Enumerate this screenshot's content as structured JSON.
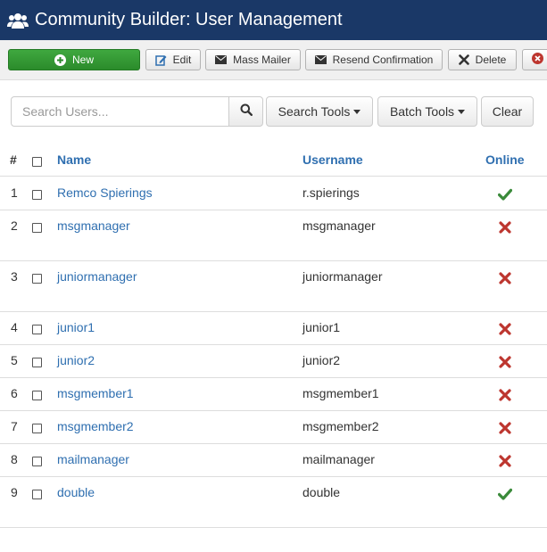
{
  "header": {
    "title": "Community Builder: User Management",
    "icon": "users-icon"
  },
  "toolbar": {
    "new_label": "New",
    "edit_label": "Edit",
    "mass_mailer_label": "Mass Mailer",
    "resend_label": "Resend Confirmation",
    "delete_label": "Delete"
  },
  "filters": {
    "search_placeholder": "Search Users...",
    "search_tools_label": "Search Tools",
    "batch_tools_label": "Batch Tools",
    "clear_label": "Clear"
  },
  "table": {
    "headers": {
      "num": "#",
      "name": "Name",
      "username": "Username",
      "online": "Online"
    },
    "rows": [
      {
        "num": "1",
        "name": "Remco Spierings",
        "username": "r.spierings",
        "online": true
      },
      {
        "num": "2",
        "name": "msgmanager",
        "username": "msgmanager",
        "online": false
      },
      {
        "num": "3",
        "name": "juniormanager",
        "username": "juniormanager",
        "online": false
      },
      {
        "num": "4",
        "name": "junior1",
        "username": "junior1",
        "online": false
      },
      {
        "num": "5",
        "name": "junior2",
        "username": "junior2",
        "online": false
      },
      {
        "num": "6",
        "name": "msgmember1",
        "username": "msgmember1",
        "online": false
      },
      {
        "num": "7",
        "name": "msgmember2",
        "username": "msgmember2",
        "online": false
      },
      {
        "num": "8",
        "name": "mailmanager",
        "username": "mailmanager",
        "online": false
      },
      {
        "num": "9",
        "name": "double",
        "username": "double",
        "online": true
      }
    ]
  },
  "colors": {
    "header_bg": "#1a3867",
    "link": "#2f6fb0",
    "online": "#3a8a3a",
    "offline": "#bd362f",
    "new_button": "#2b8b2b"
  }
}
